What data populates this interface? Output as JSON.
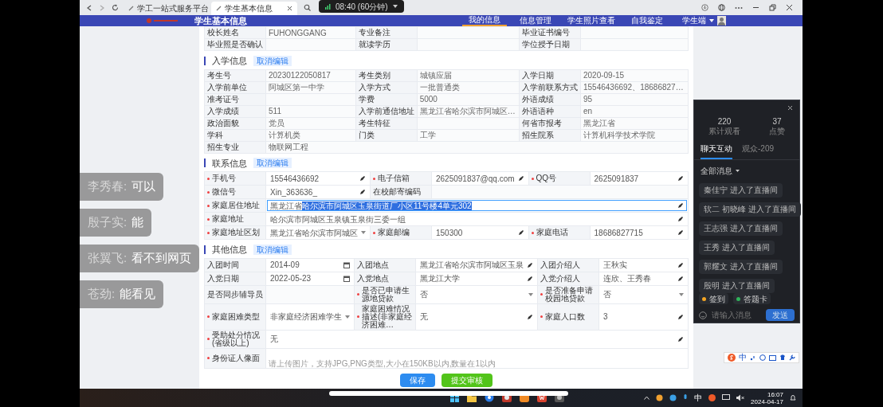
{
  "browser": {
    "tabs": [
      {
        "title": "学工一站式服务平台",
        "selected": false
      },
      {
        "title": "学生基本信息",
        "selected": true
      }
    ]
  },
  "recording": {
    "time": "08:40 (60分钟)"
  },
  "header": {
    "title": "学生基本信息",
    "nav": [
      {
        "label": "我的信息",
        "selected": true
      },
      {
        "label": "信息管理",
        "selected": false
      },
      {
        "label": "学生照片查看",
        "selected": false
      },
      {
        "label": "自我鉴定",
        "selected": false
      }
    ],
    "user": "学生端"
  },
  "sections": [
    {
      "rows": [
        [
          {
            "label": "校长姓名",
            "value": "FUHONGGANG",
            "kind": "static"
          },
          {
            "label": "专业备注",
            "kind": "static"
          },
          {
            "label": "毕业证书编号",
            "kind": "static"
          }
        ],
        [
          {
            "label": "毕业照是否确认",
            "kind": "static"
          },
          {
            "label": "就读学历",
            "kind": "static"
          },
          {
            "label": "学位授予日期",
            "kind": "static"
          }
        ]
      ]
    },
    {
      "title": "入学信息",
      "action": "取消编辑",
      "rows": [
        [
          {
            "label": "考生号",
            "value": "20230122050817",
            "kind": "static"
          },
          {
            "label": "考生类别",
            "value": "城镇应届",
            "kind": "static"
          },
          {
            "label": "入学日期",
            "value": "2020-09-15",
            "kind": "static"
          }
        ],
        [
          {
            "label": "入学前单位",
            "value": "阿城区第一中学",
            "kind": "static"
          },
          {
            "label": "入学方式",
            "value": "一批普通类",
            "kind": "static"
          },
          {
            "label": "入学前联系方式",
            "value": "15546436692、18686827…",
            "kind": "static"
          }
        ],
        [
          {
            "label": "准考证号",
            "kind": "static"
          },
          {
            "label": "学费",
            "value": "5000",
            "kind": "static"
          },
          {
            "label": "外语成绩",
            "value": "95",
            "kind": "static"
          }
        ],
        [
          {
            "label": "入学成绩",
            "value": "511",
            "kind": "static"
          },
          {
            "label": "入学前通信地址",
            "value": "黑龙江省哈尔滨市阿城区…",
            "kind": "static"
          },
          {
            "label": "外语语种",
            "value": "en",
            "kind": "static"
          }
        ],
        [
          {
            "label": "政治面貌",
            "value": "党员",
            "kind": "static"
          },
          {
            "label": "考生特征",
            "kind": "static"
          },
          {
            "label": "何省市报考",
            "value": "黑龙江省",
            "kind": "static"
          }
        ],
        [
          {
            "label": "学科",
            "value": "计算机类",
            "kind": "static"
          },
          {
            "label": "门类",
            "value": "工学",
            "kind": "static"
          },
          {
            "label": "招生院系",
            "value": "计算机科学技术学院",
            "kind": "static"
          }
        ],
        [
          {
            "label": "招生专业",
            "value": "物联网工程",
            "kind": "static"
          }
        ]
      ]
    },
    {
      "title": "联系信息",
      "action": "取消编辑",
      "rows": [
        [
          {
            "label": "手机号",
            "value": "15546436692",
            "kind": "input",
            "required": true
          },
          {
            "label": "电子信箱",
            "value": "2625091837@qq.com",
            "kind": "input",
            "required": true
          },
          {
            "label": "QQ号",
            "value": "2625091837",
            "kind": "input",
            "required": true
          }
        ],
        [
          {
            "label": "微信号",
            "value": "Xin_363636_",
            "kind": "input",
            "required": true
          },
          {
            "label": "在校邮寄编码",
            "kind": "static",
            "required": false
          }
        ],
        [
          {
            "label": "家庭居住地址",
            "value": "黑龙江省",
            "selected_text": "哈尔滨市阿城区玉泉街道厂小区11号楼4单元302",
            "kind": "input",
            "required": true,
            "focused": true
          }
        ],
        [
          {
            "label": "家庭地址",
            "value": "哈尔滨市阿城区玉泉镇玉泉街三委一组",
            "kind": "input",
            "required": true
          }
        ],
        [
          {
            "label": "家庭地址区划",
            "value": "黑龙江省哈尔滨市阿城区",
            "kind": "select",
            "required": true
          },
          {
            "label": "家庭邮编",
            "value": "150300",
            "kind": "input",
            "required": true
          },
          {
            "label": "家庭电话",
            "value": "18686827715",
            "kind": "input",
            "required": true
          }
        ]
      ]
    },
    {
      "title": "其他信息",
      "action": "取消编辑",
      "rows": [
        [
          {
            "label": "入团时间",
            "value": "2014-09",
            "kind": "date"
          },
          {
            "label": "入团地点",
            "value": "黑龙江省哈尔滨市阿城区玉泉",
            "kind": "input"
          },
          {
            "label": "入团介绍人",
            "value": "王秋实",
            "kind": "input"
          }
        ],
        [
          {
            "label": "入党日期",
            "value": "2022-05-23",
            "kind": "date"
          },
          {
            "label": "入党地点",
            "value": "黑龙江大学",
            "kind": "input"
          },
          {
            "label": "入党介绍人",
            "value": "连欣、王秀春",
            "kind": "input"
          }
        ],
        [
          {
            "label": "是否同步辅导员",
            "kind": "static"
          },
          {
            "label": "是否已申请生源地贷款",
            "value": "否",
            "kind": "select",
            "required": true
          },
          {
            "label": "是否准备申请校园地贷款",
            "value": "否",
            "kind": "select",
            "required": true
          }
        ],
        [
          {
            "label": "家庭困难类型",
            "value": "非家庭经济困难学生",
            "kind": "select",
            "required": true
          },
          {
            "label": "家庭困难情况描述(非家庭经济困难…",
            "value": "无",
            "kind": "input",
            "required": true
          },
          {
            "label": "家庭人口数",
            "value": "3",
            "kind": "input",
            "required": true
          }
        ],
        [
          {
            "label": "受助处分情况(省级以上)",
            "value": "无",
            "kind": "input",
            "required": true
          }
        ],
        [
          {
            "label": "身份证人像面",
            "hint": "请上传图片，支持JPG,PNG类型,大小在150KB以内,数量在1以内",
            "kind": "upload",
            "required": true
          }
        ]
      ]
    }
  ],
  "actions": [
    {
      "label": "保存",
      "kind": "primary"
    },
    {
      "label": "提交审核",
      "kind": "success"
    }
  ],
  "danmaku": [
    {
      "sender": "李秀春:",
      "message": "可以"
    },
    {
      "sender": "殷子实:",
      "message": "能"
    },
    {
      "sender": "张翼飞:",
      "message": "看不到网页"
    },
    {
      "sender": "苍劲:",
      "message": "能看见"
    }
  ],
  "live_panel": {
    "stats": [
      {
        "value": "220",
        "label": "累计观看"
      },
      {
        "value": "37",
        "label": "点赞"
      }
    ],
    "tabs": [
      {
        "label": "聊天互动",
        "selected": true
      },
      {
        "label": "观众-209",
        "selected": false
      }
    ],
    "filter": "全部消息",
    "messages": [
      "秦佳宁 进入了直播间",
      "软二 初晓峰 进入了直播间",
      "王志强 进入了直播间",
      "王秀 进入了直播间",
      "郭耀文 进入了直播间",
      "殷明 进入了直播间"
    ],
    "buttons": [
      {
        "label": "签到",
        "color": "#f5a623"
      },
      {
        "label": "答题卡",
        "color": "#2fb35a"
      }
    ],
    "input": {
      "placeholder": "请输入消息"
    },
    "send": "发送"
  },
  "ime": {
    "mode": "中"
  },
  "taskbar": {
    "ime": "中",
    "time": "16:07",
    "date": "2024-04-17"
  }
}
